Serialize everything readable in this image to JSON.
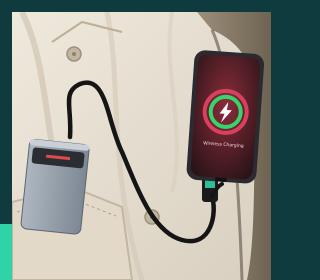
{
  "image": {
    "phone_screen_text": "Wireless Charging",
    "colors": {
      "background": "#0f3a3e",
      "accent": "#2fd3a6",
      "fabric": "#e6dfd2",
      "fabric_shadow": "#cfc6b6",
      "backpack": "#8a7d6a",
      "phone_body": "#2a2a30",
      "ring_outer": "#d9405f",
      "ring_inner": "#39d36a",
      "power_bank": "#8f9aa6",
      "cable": "#151515"
    }
  }
}
